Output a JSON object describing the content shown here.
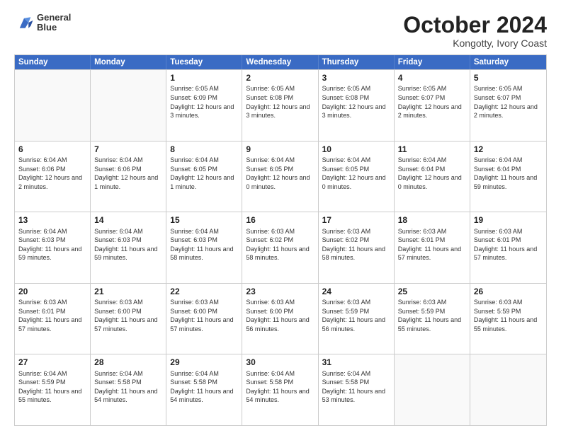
{
  "logo": {
    "line1": "General",
    "line2": "Blue"
  },
  "title": "October 2024",
  "subtitle": "Kongotty, Ivory Coast",
  "headers": [
    "Sunday",
    "Monday",
    "Tuesday",
    "Wednesday",
    "Thursday",
    "Friday",
    "Saturday"
  ],
  "weeks": [
    [
      {
        "day": "",
        "info": ""
      },
      {
        "day": "",
        "info": ""
      },
      {
        "day": "1",
        "info": "Sunrise: 6:05 AM\nSunset: 6:09 PM\nDaylight: 12 hours and 3 minutes."
      },
      {
        "day": "2",
        "info": "Sunrise: 6:05 AM\nSunset: 6:08 PM\nDaylight: 12 hours and 3 minutes."
      },
      {
        "day": "3",
        "info": "Sunrise: 6:05 AM\nSunset: 6:08 PM\nDaylight: 12 hours and 3 minutes."
      },
      {
        "day": "4",
        "info": "Sunrise: 6:05 AM\nSunset: 6:07 PM\nDaylight: 12 hours and 2 minutes."
      },
      {
        "day": "5",
        "info": "Sunrise: 6:05 AM\nSunset: 6:07 PM\nDaylight: 12 hours and 2 minutes."
      }
    ],
    [
      {
        "day": "6",
        "info": "Sunrise: 6:04 AM\nSunset: 6:06 PM\nDaylight: 12 hours and 2 minutes."
      },
      {
        "day": "7",
        "info": "Sunrise: 6:04 AM\nSunset: 6:06 PM\nDaylight: 12 hours and 1 minute."
      },
      {
        "day": "8",
        "info": "Sunrise: 6:04 AM\nSunset: 6:05 PM\nDaylight: 12 hours and 1 minute."
      },
      {
        "day": "9",
        "info": "Sunrise: 6:04 AM\nSunset: 6:05 PM\nDaylight: 12 hours and 0 minutes."
      },
      {
        "day": "10",
        "info": "Sunrise: 6:04 AM\nSunset: 6:05 PM\nDaylight: 12 hours and 0 minutes."
      },
      {
        "day": "11",
        "info": "Sunrise: 6:04 AM\nSunset: 6:04 PM\nDaylight: 12 hours and 0 minutes."
      },
      {
        "day": "12",
        "info": "Sunrise: 6:04 AM\nSunset: 6:04 PM\nDaylight: 11 hours and 59 minutes."
      }
    ],
    [
      {
        "day": "13",
        "info": "Sunrise: 6:04 AM\nSunset: 6:03 PM\nDaylight: 11 hours and 59 minutes."
      },
      {
        "day": "14",
        "info": "Sunrise: 6:04 AM\nSunset: 6:03 PM\nDaylight: 11 hours and 59 minutes."
      },
      {
        "day": "15",
        "info": "Sunrise: 6:04 AM\nSunset: 6:03 PM\nDaylight: 11 hours and 58 minutes."
      },
      {
        "day": "16",
        "info": "Sunrise: 6:03 AM\nSunset: 6:02 PM\nDaylight: 11 hours and 58 minutes."
      },
      {
        "day": "17",
        "info": "Sunrise: 6:03 AM\nSunset: 6:02 PM\nDaylight: 11 hours and 58 minutes."
      },
      {
        "day": "18",
        "info": "Sunrise: 6:03 AM\nSunset: 6:01 PM\nDaylight: 11 hours and 57 minutes."
      },
      {
        "day": "19",
        "info": "Sunrise: 6:03 AM\nSunset: 6:01 PM\nDaylight: 11 hours and 57 minutes."
      }
    ],
    [
      {
        "day": "20",
        "info": "Sunrise: 6:03 AM\nSunset: 6:01 PM\nDaylight: 11 hours and 57 minutes."
      },
      {
        "day": "21",
        "info": "Sunrise: 6:03 AM\nSunset: 6:00 PM\nDaylight: 11 hours and 57 minutes."
      },
      {
        "day": "22",
        "info": "Sunrise: 6:03 AM\nSunset: 6:00 PM\nDaylight: 11 hours and 57 minutes."
      },
      {
        "day": "23",
        "info": "Sunrise: 6:03 AM\nSunset: 6:00 PM\nDaylight: 11 hours and 56 minutes."
      },
      {
        "day": "24",
        "info": "Sunrise: 6:03 AM\nSunset: 5:59 PM\nDaylight: 11 hours and 56 minutes."
      },
      {
        "day": "25",
        "info": "Sunrise: 6:03 AM\nSunset: 5:59 PM\nDaylight: 11 hours and 55 minutes."
      },
      {
        "day": "26",
        "info": "Sunrise: 6:03 AM\nSunset: 5:59 PM\nDaylight: 11 hours and 55 minutes."
      }
    ],
    [
      {
        "day": "27",
        "info": "Sunrise: 6:04 AM\nSunset: 5:59 PM\nDaylight: 11 hours and 55 minutes."
      },
      {
        "day": "28",
        "info": "Sunrise: 6:04 AM\nSunset: 5:58 PM\nDaylight: 11 hours and 54 minutes."
      },
      {
        "day": "29",
        "info": "Sunrise: 6:04 AM\nSunset: 5:58 PM\nDaylight: 11 hours and 54 minutes."
      },
      {
        "day": "30",
        "info": "Sunrise: 6:04 AM\nSunset: 5:58 PM\nDaylight: 11 hours and 54 minutes."
      },
      {
        "day": "31",
        "info": "Sunrise: 6:04 AM\nSunset: 5:58 PM\nDaylight: 11 hours and 53 minutes."
      },
      {
        "day": "",
        "info": ""
      },
      {
        "day": "",
        "info": ""
      }
    ]
  ]
}
